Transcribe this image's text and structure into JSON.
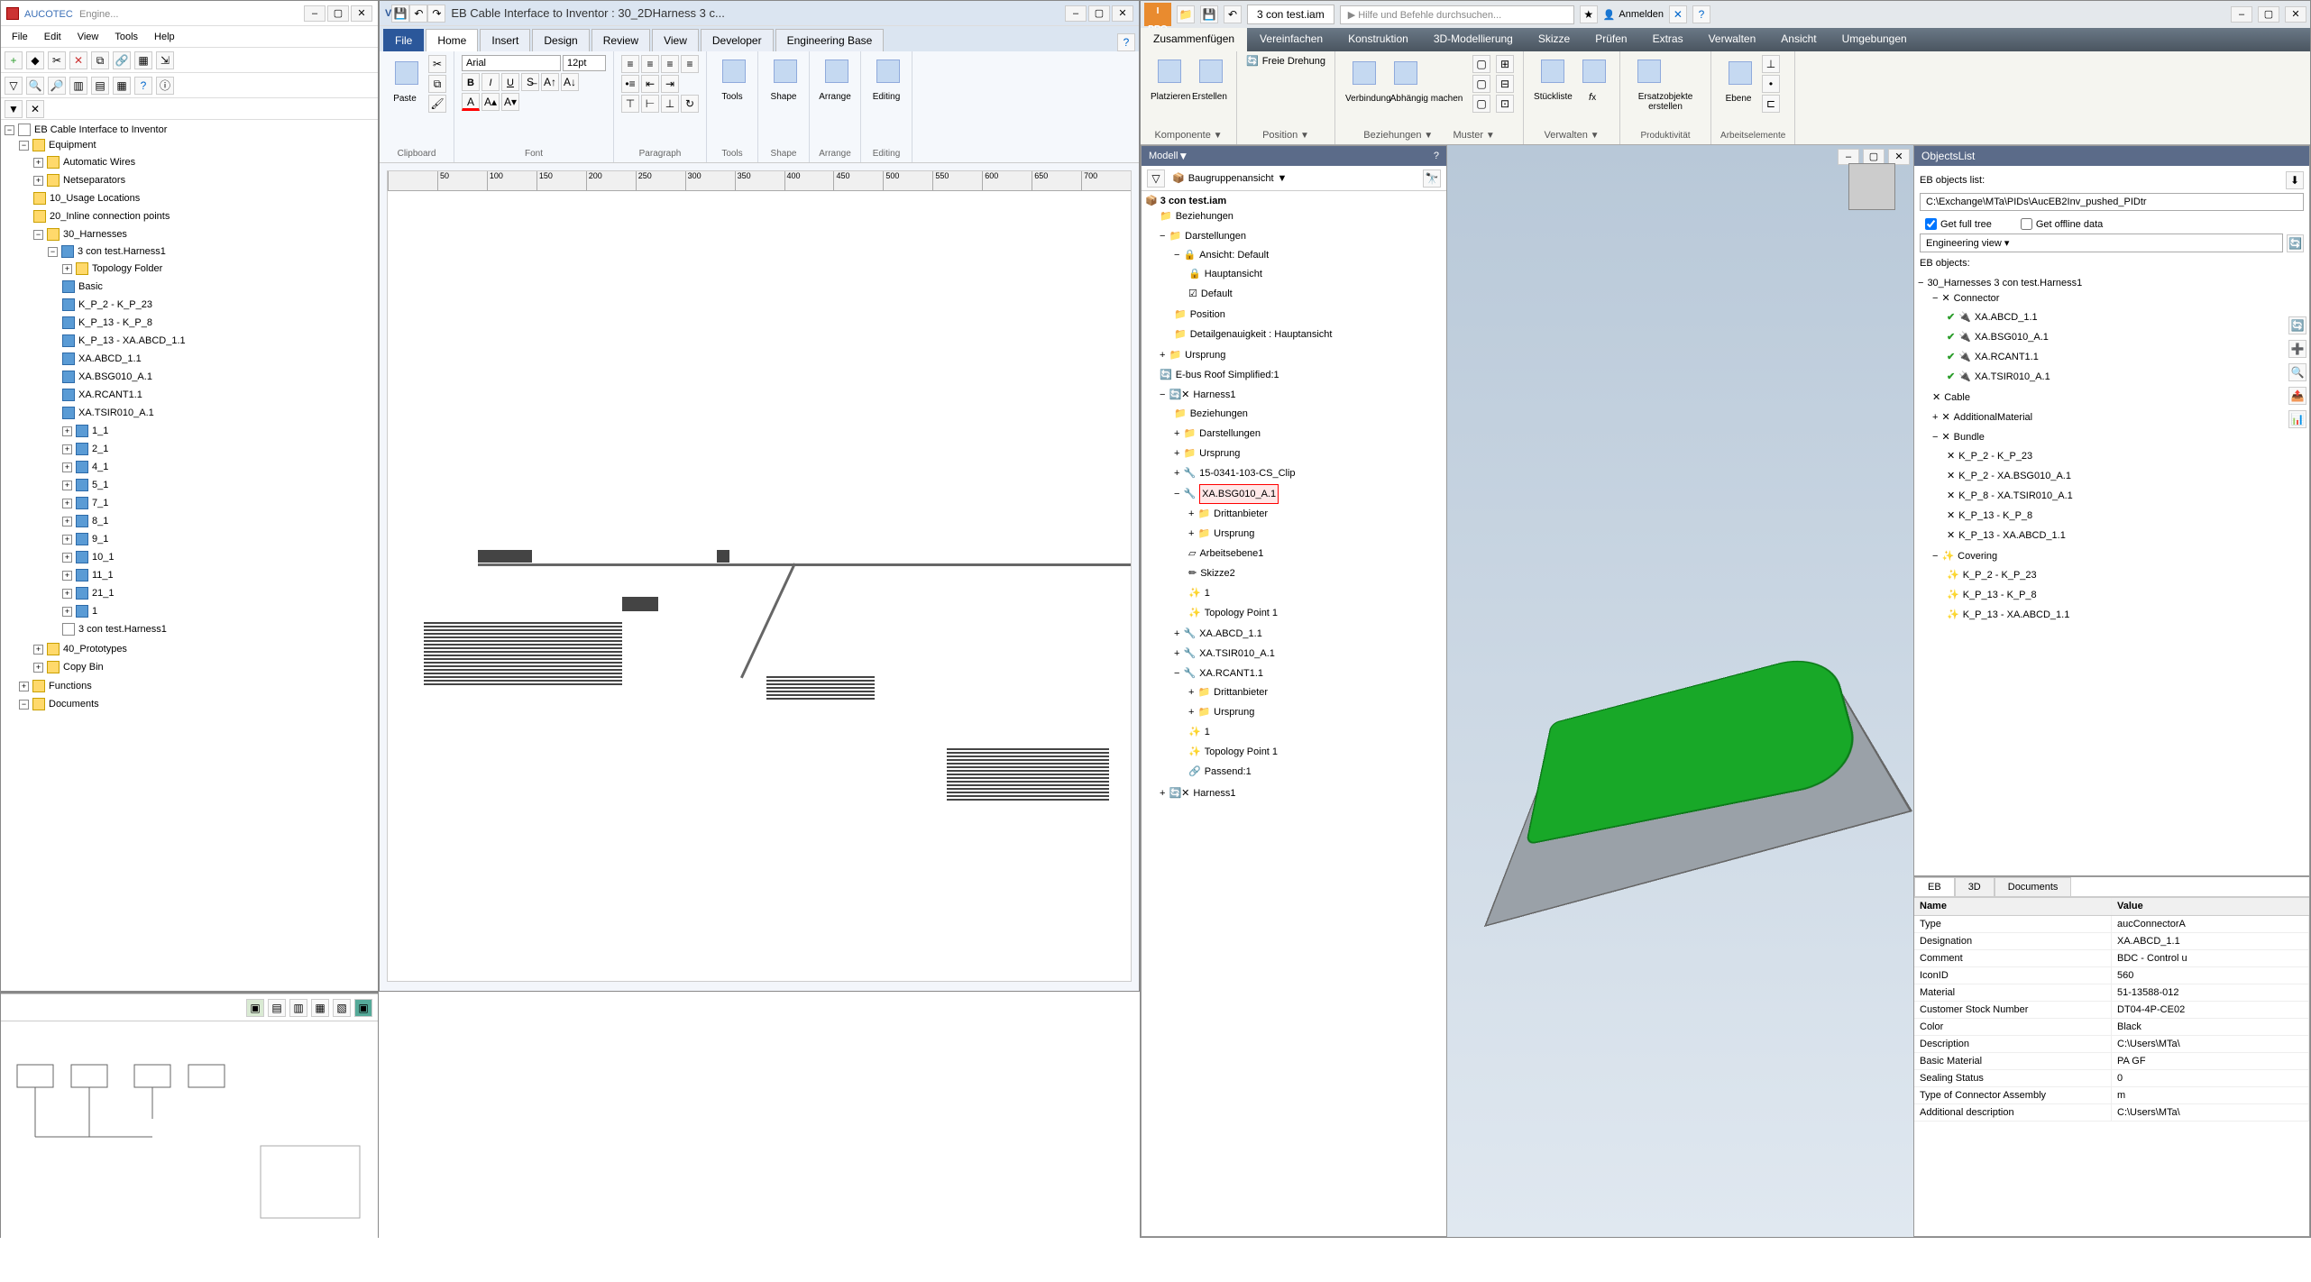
{
  "aucotec": {
    "title_brand": "AUCOTEC",
    "title_project": "Engine...",
    "menus": [
      "File",
      "Edit",
      "View",
      "Tools",
      "Help"
    ],
    "tree_root": "EB Cable Interface to Inventor",
    "tree": {
      "equipment": "Equipment",
      "automatic_wires": "Automatic Wires",
      "netseparators": "Netseparators",
      "usage_locations": "10_Usage Locations",
      "inline_connection": "20_Inline connection points",
      "harnesses": "30_Harnesses",
      "harness1": "3 con test.Harness1",
      "topology_folder": "Topology Folder",
      "basic": "Basic",
      "kp2_kp23": "K_P_2 - K_P_23",
      "kp13_kp8": "K_P_13 - K_P_8",
      "kp13_xaabcd": "K_P_13 - XA.ABCD_1.1",
      "xaabcd": "XA.ABCD_1.1",
      "xabsg": "XA.BSG010_A.1",
      "xarcant": "XA.RCANT1.1",
      "xatsir": "XA.TSIR010_A.1",
      "n1_1": "1_1",
      "n2_1": "2_1",
      "n4_1": "4_1",
      "n5_1": "5_1",
      "n7_1": "7_1",
      "n8_1": "8_1",
      "n9_1": "9_1",
      "n10_1": "10_1",
      "n11_1": "11_1",
      "n21_1": "21_1",
      "n1": "1",
      "harness1b": "3 con test.Harness1",
      "prototypes": "40_Prototypes",
      "copy_bin": "Copy Bin",
      "functions": "Functions",
      "documents": "Documents"
    }
  },
  "visio": {
    "title": "EB Cable Interface to Inventor : 30_2DHarness 3 c...",
    "tabs": {
      "file": "File",
      "home": "Home",
      "insert": "Insert",
      "design": "Design",
      "review": "Review",
      "view": "View",
      "developer": "Developer",
      "engineering_base": "Engineering Base"
    },
    "groups": {
      "clipboard": "Clipboard",
      "font": "Font",
      "paragraph": "Paragraph",
      "tools": "Tools",
      "shape": "Shape",
      "arrange": "Arrange",
      "editing": "Editing"
    },
    "paste": "Paste",
    "font_name": "Arial",
    "font_size": "12pt",
    "tools": "Tools",
    "shape": "Shape",
    "arrange": "Arrange",
    "editing": "Editing",
    "ruler_ticks": [
      "",
      "50",
      "100",
      "150",
      "200",
      "250",
      "300",
      "350",
      "400",
      "450",
      "500",
      "550",
      "600",
      "650",
      "700"
    ]
  },
  "inventor": {
    "tab_title": "3 con test.iam",
    "search_placeholder": "Hilfe und Befehle durchsuchen...",
    "anmelden": "Anmelden",
    "ribbon_tabs": [
      "Zusammenfügen",
      "Vereinfachen",
      "Konstruktion",
      "3D-Modellierung",
      "Skizze",
      "Prüfen",
      "Extras",
      "Verwalten",
      "Ansicht",
      "Umgebungen"
    ],
    "ribbon": {
      "platzieren": "Platzieren",
      "erstellen": "Erstellen",
      "freie_drehung": "Freie Drehung",
      "verbindung": "Verbindung",
      "abhaengig": "Abhängig machen",
      "stueckliste": "Stückliste",
      "parameter": "Parameter",
      "ersatzobjekte": "Ersatzobjekte\nerstellen",
      "ebene": "Ebene",
      "g_komponente": "Komponente",
      "g_position": "Position",
      "g_beziehungen": "Beziehungen",
      "g_muster": "Muster",
      "g_verwalten": "Verwalten",
      "g_produktivitaet": "Produktivität",
      "g_arbeitselemente": "Arbeitselemente"
    },
    "modell": {
      "title": "Modell",
      "baugruppenansicht": "Baugruppenansicht",
      "root": "3 con test.iam",
      "beziehungen": "Beziehungen",
      "darstellungen": "Darstellungen",
      "ansicht_default": "Ansicht: Default",
      "hauptansicht": "Hauptansicht",
      "default": "Default",
      "position": "Position",
      "detailgenauigkeit": "Detailgenauigkeit : Hauptansicht",
      "ursprung": "Ursprung",
      "ebus": "E-bus Roof Simplified:1",
      "harness1": "Harness1",
      "clip": "15-0341-103-CS_Clip",
      "xabsg": "XA.BSG010_A.1",
      "drittanbieter": "Drittanbieter",
      "arbeitsebene1": "Arbeitsebene1",
      "skizze2": "Skizze2",
      "one": "1",
      "topology_point1": "Topology Point 1",
      "xaabcd": "XA.ABCD_1.1",
      "xatsir": "XA.TSIR010_A.1",
      "xarcant": "XA.RCANT1.1",
      "passend1": "Passend:1",
      "harness1b": "Harness1"
    },
    "objectslist": {
      "title": "ObjectsList",
      "eb_objects_list": "EB objects list:",
      "path": "C:\\Exchange\\MTa\\PIDs\\AucEB2Inv_pushed_PIDtr",
      "get_full_tree": "Get full tree",
      "get_offline_data": "Get offline data",
      "engineering_view": "Engineering view",
      "eb_objects": "EB objects:",
      "root": "30_Harnesses 3 con test.Harness1",
      "connector": "Connector",
      "xaabcd": "XA.ABCD_1.1",
      "xabsg": "XA.BSG010_A.1",
      "xarcant": "XA.RCANT1.1",
      "xatsir": "XA.TSIR010_A.1",
      "cable": "Cable",
      "additional": "AdditionalMaterial",
      "bundle": "Bundle",
      "b1": "K_P_2 - K_P_23",
      "b2": "K_P_2 - XA.BSG010_A.1",
      "b3": "K_P_8 - XA.TSIR010_A.1",
      "b4": "K_P_13 - K_P_8",
      "b5": "K_P_13 - XA.ABCD_1.1",
      "covering": "Covering",
      "c1": "K_P_2 - K_P_23",
      "c2": "K_P_13 - K_P_8",
      "c3": "K_P_13 - XA.ABCD_1.1"
    },
    "proptabs": {
      "eb": "EB",
      "d3": "3D",
      "documents": "Documents"
    },
    "props_hdr": {
      "name": "Name",
      "value": "Value"
    },
    "props": [
      [
        "Type",
        "aucConnectorA"
      ],
      [
        "Designation",
        "XA.ABCD_1.1"
      ],
      [
        "Comment",
        "BDC - Control u"
      ],
      [
        "IconID",
        "560"
      ],
      [
        "Material",
        "51-13588-012"
      ],
      [
        "Customer Stock Number",
        "DT04-4P-CE02"
      ],
      [
        "Color",
        "Black"
      ],
      [
        "Description",
        "C:\\Users\\MTa\\"
      ],
      [
        "Basic Material",
        "PA GF"
      ],
      [
        "Sealing Status",
        "0"
      ],
      [
        "Type of Connector Assembly",
        "m"
      ],
      [
        "Additional description",
        "C:\\Users\\MTa\\"
      ]
    ]
  }
}
